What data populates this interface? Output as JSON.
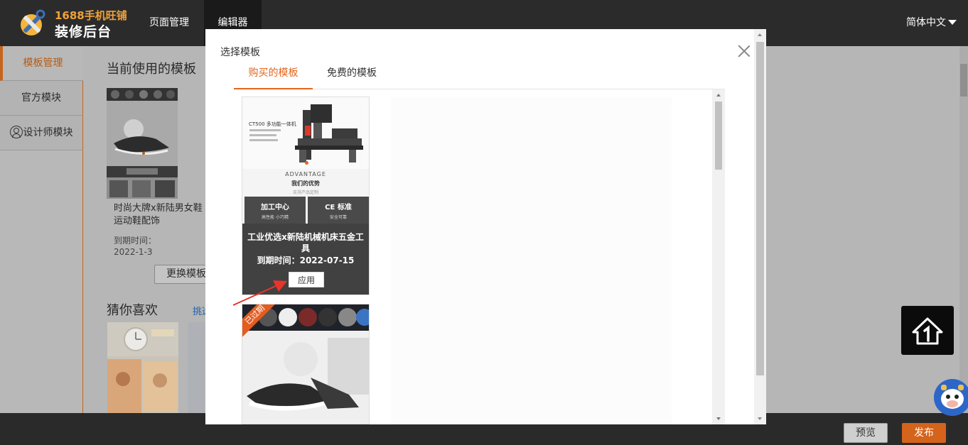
{
  "header": {
    "logo_top": "1688手机旺铺",
    "logo_main": "装修后台",
    "nav": [
      {
        "label": "页面管理",
        "active": false
      },
      {
        "label": "编辑器",
        "active": true
      }
    ],
    "language": "简体中文"
  },
  "sidebar": {
    "items": [
      {
        "label": "模板管理",
        "active": true
      },
      {
        "label": "官方模块",
        "active": false
      },
      {
        "label": "设计师模块",
        "active": false
      }
    ]
  },
  "current_template": {
    "title": "当前使用的模板",
    "name": "时尚大牌x新陆男女鞋运动鞋配饰",
    "expiry_label": "到期时间：",
    "expiry_date": "2022-1-3",
    "change_button": "更换模板"
  },
  "guess": {
    "title": "猜你喜欢",
    "link": "挑选"
  },
  "modal": {
    "title": "选择模板",
    "tabs": [
      {
        "label": "购买的模板",
        "active": true
      },
      {
        "label": "免费的模板",
        "active": false
      }
    ],
    "cards": [
      {
        "hero_title": "CT500 多功能一体机",
        "section_en": "ADVANTAGE",
        "section_cn": "我们的优势",
        "section_sub": "支持产品定制",
        "box1_title": "加工中心",
        "box1_sub": "高性能 小巧精",
        "box2_title": "CE 标准",
        "box2_sub": "安全可靠",
        "name": "工业优选x新陆机械机床五金工具",
        "expiry": "到期时间：2022-07-15",
        "apply_button": "应用"
      },
      {
        "ribbon": "已过期"
      }
    ]
  },
  "footer": {
    "preview": "预览",
    "publish": "发布"
  },
  "colors": {
    "accent": "#e2661e",
    "topbar": "#2b2b2b",
    "publish": "#d4631b"
  }
}
